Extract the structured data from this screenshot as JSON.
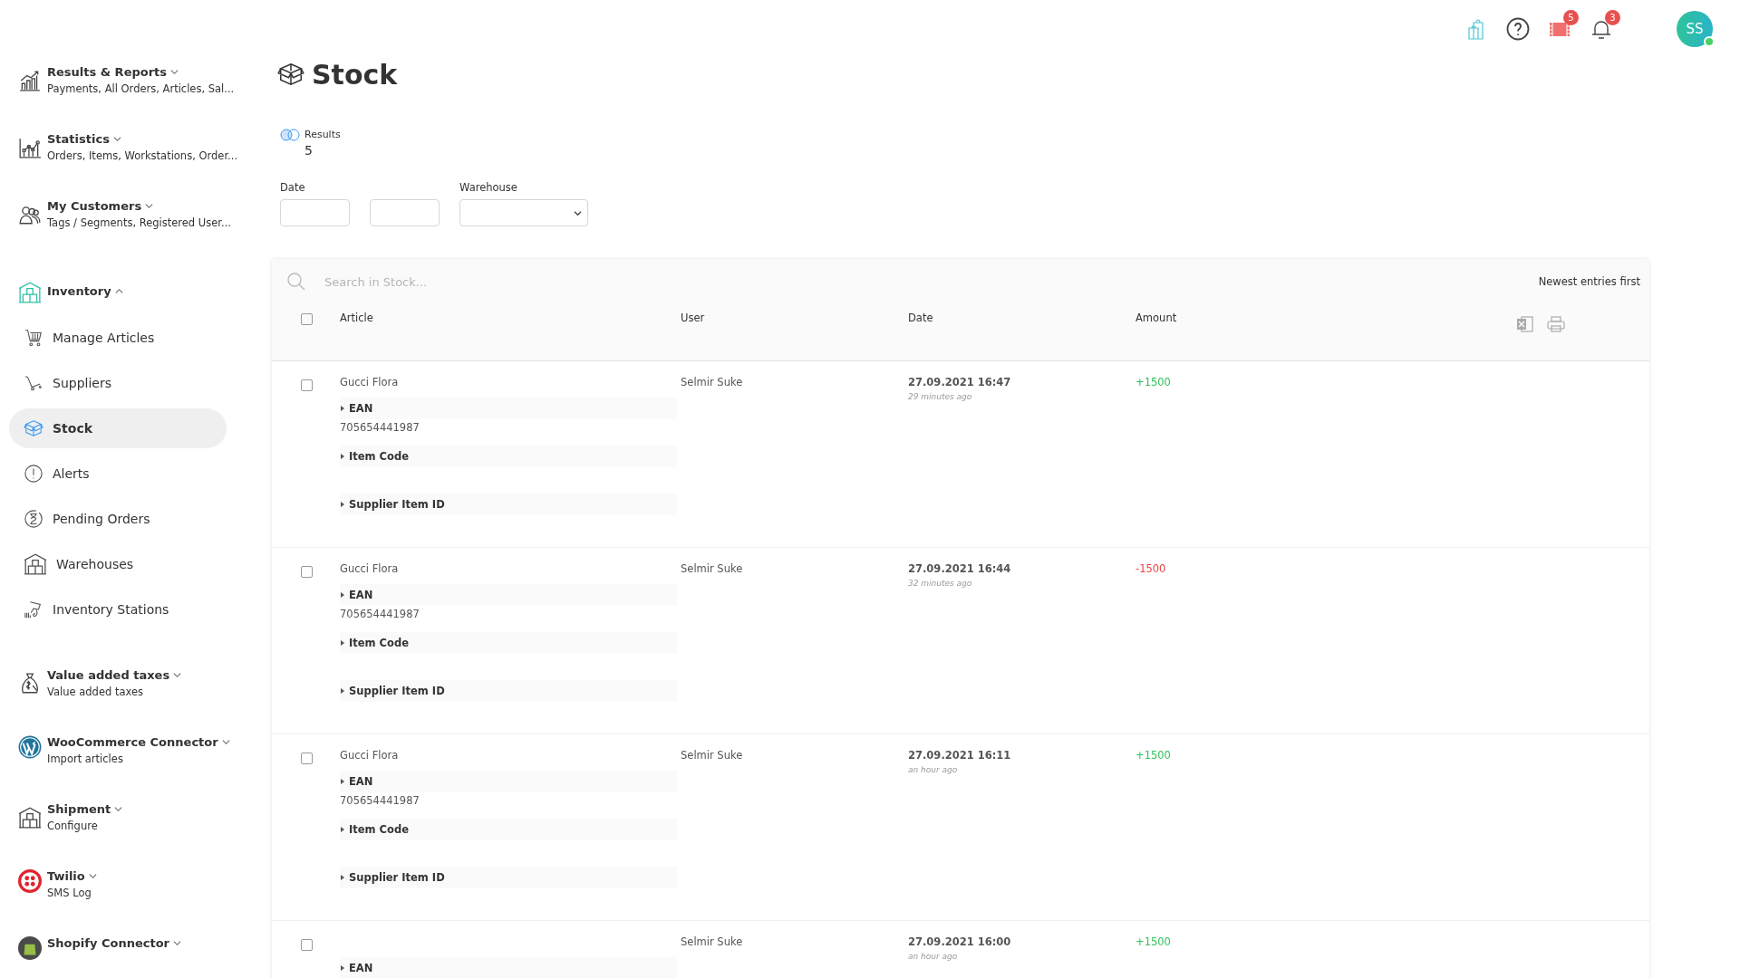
{
  "topbar": {
    "icons": [
      {
        "kind": "shop"
      },
      {
        "kind": "help"
      },
      {
        "kind": "video",
        "badge": "5"
      },
      {
        "kind": "bell",
        "badge": "3"
      }
    ],
    "avatar": {
      "initials": "SS",
      "online": true
    }
  },
  "sidebar": {
    "groups": [
      {
        "kind": "reports",
        "title": "Results & Reports",
        "subtitle": "Payments, All Orders, Articles, Sal...",
        "expanded": false
      },
      {
        "kind": "statistics",
        "title": "Statistics",
        "subtitle": "Orders, Items, Workstations, Order...",
        "expanded": false
      },
      {
        "kind": "customers",
        "title": "My Customers",
        "subtitle": "Tags / Segments, Registered User...",
        "expanded": false
      },
      {
        "kind": "inventory",
        "title": "Inventory",
        "expanded": true,
        "children": [
          {
            "kind": "cart",
            "label": "Manage Articles",
            "selected": false
          },
          {
            "kind": "dolly",
            "label": "Suppliers",
            "selected": false
          },
          {
            "kind": "box",
            "label": "Stock",
            "selected": true
          },
          {
            "kind": "alert",
            "label": "Alerts",
            "selected": false
          },
          {
            "kind": "hourglass",
            "label": "Pending Orders",
            "selected": false
          },
          {
            "kind": "warehouse",
            "label": "Warehouses",
            "selected": false
          },
          {
            "kind": "scanner",
            "label": "Inventory Stations",
            "selected": false
          }
        ]
      },
      {
        "kind": "tax",
        "title": "Value added taxes",
        "subtitle": "Value added taxes",
        "expanded": false
      },
      {
        "kind": "wordpress",
        "title": "WooCommerce Connector",
        "subtitle": "Import articles",
        "expanded": false
      },
      {
        "kind": "warehouse",
        "title": "Shipment",
        "subtitle": "Configure",
        "expanded": false
      },
      {
        "kind": "twilio",
        "title": "Twilio",
        "subtitle": "SMS Log",
        "expanded": false
      },
      {
        "kind": "shopify",
        "title": "Shopify Connector",
        "expanded": false
      }
    ]
  },
  "page": {
    "title": "Stock",
    "results": {
      "label": "Results",
      "count": "5"
    },
    "filters": {
      "date_label": "Date",
      "warehouse_label": "Warehouse"
    },
    "search": {
      "placeholder": "Search in Stock..."
    },
    "sort": "Newest entries first",
    "select_all": {
      "checked": false
    },
    "columns": [
      "Article",
      "User",
      "Date",
      "Amount"
    ],
    "rows": [
      {
        "checked": false,
        "article": "Gucci Flora",
        "user": "Selmir Suke",
        "date": "27.09.2021 16:47",
        "ago": "29 minutes ago",
        "amount": "+1500",
        "kind": "increase",
        "fields": [
          {
            "label": "EAN",
            "value": "705654441987"
          },
          {
            "label": "Item Code"
          },
          {
            "label": "Supplier Item ID"
          }
        ]
      },
      {
        "checked": false,
        "article": "Gucci Flora",
        "user": "Selmir Suke",
        "date": "27.09.2021 16:44",
        "ago": "32 minutes ago",
        "amount": "-1500",
        "kind": "decrease",
        "fields": [
          {
            "label": "EAN",
            "value": "705654441987"
          },
          {
            "label": "Item Code"
          },
          {
            "label": "Supplier Item ID"
          }
        ]
      },
      {
        "checked": false,
        "article": "Gucci Flora",
        "user": "Selmir Suke",
        "date": "27.09.2021 16:11",
        "ago": "an hour ago",
        "amount": "+1500",
        "kind": "increase",
        "fields": [
          {
            "label": "EAN",
            "value": "705654441987"
          },
          {
            "label": "Item Code"
          },
          {
            "label": "Supplier Item ID"
          }
        ]
      },
      {
        "checked": false,
        "user": "Selmir Suke",
        "date": "27.09.2021 16:00",
        "ago": "an hour ago",
        "amount": "+1500",
        "kind": "increase",
        "fields": [
          {
            "label": "EAN"
          }
        ]
      }
    ]
  }
}
